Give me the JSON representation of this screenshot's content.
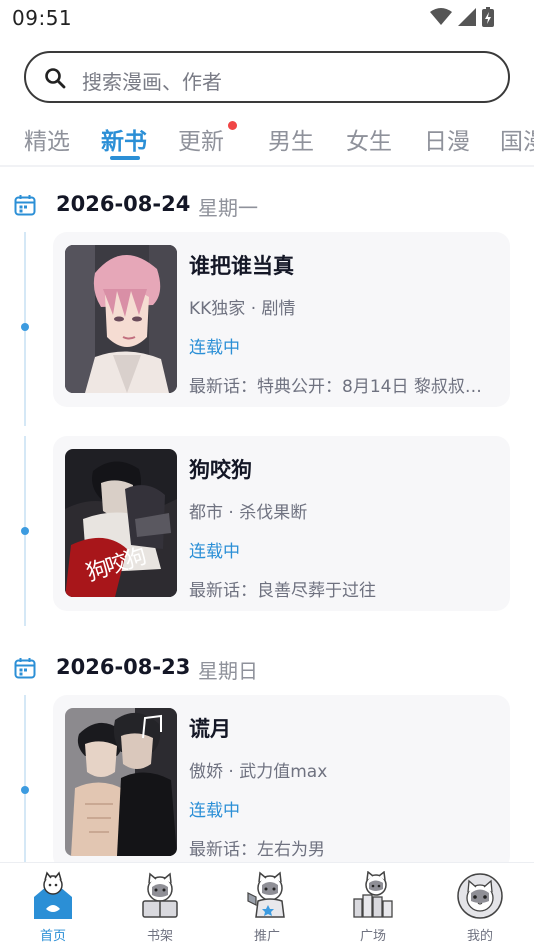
{
  "status_bar": {
    "time": "09:51"
  },
  "search": {
    "placeholder": "搜索漫画、作者"
  },
  "tabs": [
    {
      "label": "精选"
    },
    {
      "label": "新书",
      "active": true
    },
    {
      "label": "更新",
      "badge": true
    },
    {
      "label": "男生"
    },
    {
      "label": "女生"
    },
    {
      "label": "日漫"
    },
    {
      "label": "国漫"
    }
  ],
  "sections": [
    {
      "date": "2026-08-24",
      "weekday": "星期一",
      "books": [
        {
          "title": "谁把谁当真",
          "meta": "KK独家 · 剧情",
          "status": "连载中",
          "latest": "最新话：特典公开：8月14日 黎叔叔…",
          "cover_icon": "cover-pink-hair-man"
        },
        {
          "title": "狗咬狗",
          "meta": "都市 · 杀伐果断",
          "status": "连载中",
          "latest": "最新话：良善尽葬于过往",
          "cover_icon": "cover-dark-duo",
          "cover_text": "狗咬狗"
        }
      ]
    },
    {
      "date": "2026-08-23",
      "weekday": "星期日",
      "books": [
        {
          "title": "谎月",
          "meta": "傲娇 · 武力值max",
          "status": "连载中",
          "latest": "最新话：左右为男",
          "cover_icon": "cover-two-men"
        }
      ]
    }
  ],
  "bottom_nav": [
    {
      "label": "首页",
      "active": true,
      "icon": "home-cat-icon"
    },
    {
      "label": "书架",
      "icon": "shelf-cat-icon"
    },
    {
      "label": "推广",
      "icon": "promo-cat-icon"
    },
    {
      "label": "广场",
      "icon": "plaza-cat-icon"
    },
    {
      "label": "我的",
      "icon": "profile-cat-icon"
    }
  ],
  "colors": {
    "accent": "#2b8fd6",
    "badge": "#f04646",
    "card_bg": "#f7f7f9",
    "muted": "#8f929b"
  }
}
